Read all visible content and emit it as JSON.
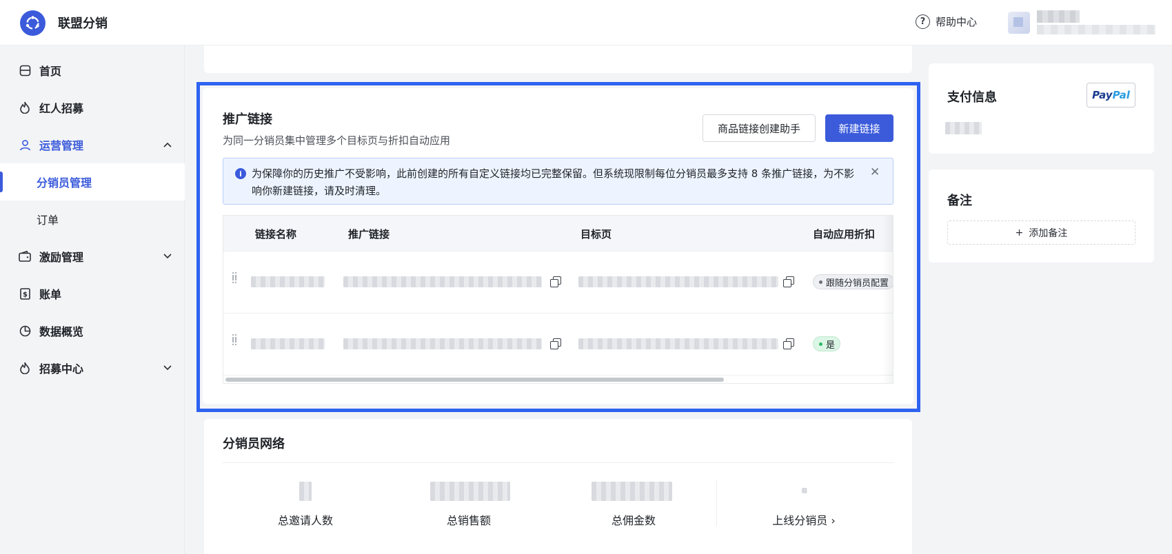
{
  "app": {
    "name": "联盟分销"
  },
  "header": {
    "help_label": "帮助中心"
  },
  "sidebar": {
    "items": [
      {
        "label": "首页",
        "icon": "home-icon"
      },
      {
        "label": "红人招募",
        "icon": "flame-icon"
      },
      {
        "label": "运营管理",
        "icon": "user-icon",
        "expanded": true
      },
      {
        "label": "分销员管理",
        "sub": true,
        "current": true
      },
      {
        "label": "订单",
        "sub": true
      },
      {
        "label": "激励管理",
        "icon": "wallet-icon"
      },
      {
        "label": "账单",
        "icon": "dollar-icon"
      },
      {
        "label": "数据概览",
        "icon": "pie-chart-icon"
      },
      {
        "label": "招募中心",
        "icon": "flame-icon"
      }
    ]
  },
  "links_section": {
    "title": "推广链接",
    "subtitle": "为同一分销员集中管理多个目标页与折扣自动应用",
    "helper_button": "商品链接创建助手",
    "new_button": "新建链接",
    "alert_text": "为保障你的历史推广不受影响，此前创建的所有自定义链接均已完整保留。但系统现限制每位分销员最多支持 8 条推广链接，为不影响你新建链接，请及时清理。",
    "table": {
      "columns": [
        "链接名称",
        "推广链接",
        "目标页",
        "自动应用折扣"
      ],
      "rows": [
        {
          "discount_tag": "跟随分销员配置",
          "tag_style": "gray"
        },
        {
          "discount_tag": "是",
          "tag_style": "green"
        }
      ]
    }
  },
  "network_section": {
    "title": "分销员网络",
    "stats": [
      "总邀请人数",
      "总销售额",
      "总佣金数",
      "上线分销员 ›"
    ]
  },
  "payment_section": {
    "title": "支付信息",
    "paypal": {
      "part1": "Pay",
      "part2": "Pal"
    }
  },
  "notes_section": {
    "title": "备注",
    "add_label": "添加备注"
  },
  "colors": {
    "primary": "#3b5bdb",
    "highlight": "#2e62f0"
  }
}
